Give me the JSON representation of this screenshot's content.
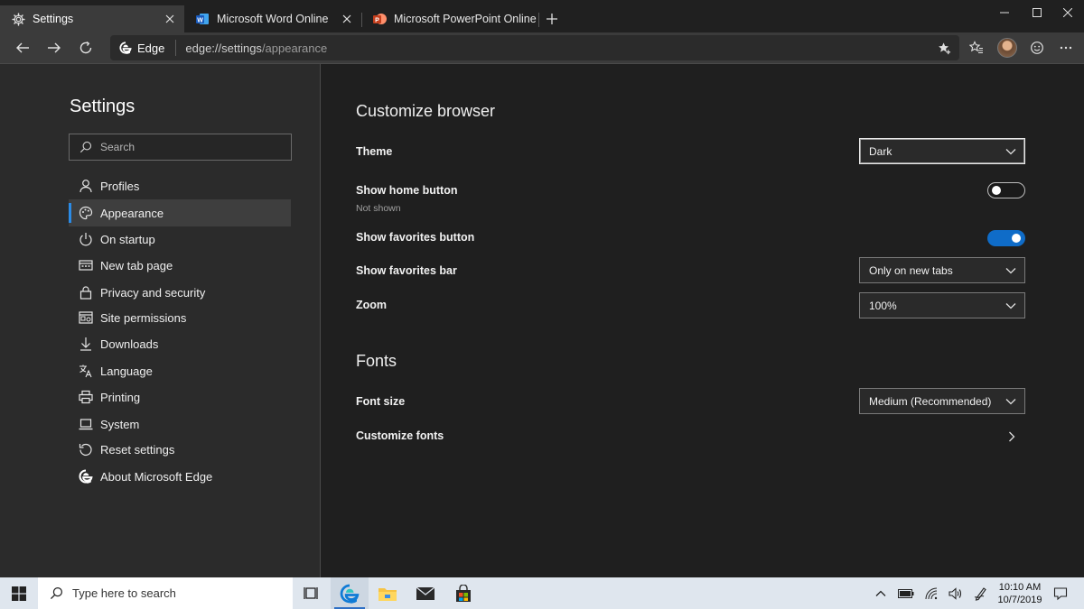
{
  "browser": {
    "tabs": [
      {
        "label": "Settings",
        "icon": "gear-icon"
      },
      {
        "label": "Microsoft Word Online",
        "icon": "word-icon"
      },
      {
        "label": "Microsoft PowerPoint Online",
        "icon": "powerpoint-icon"
      }
    ],
    "address": {
      "badge": "Edge",
      "host": "edge://settings",
      "path": "/appearance"
    }
  },
  "sidebar": {
    "title": "Settings",
    "search_placeholder": "Search",
    "items": [
      {
        "label": "Profiles",
        "icon": "person-icon"
      },
      {
        "label": "Appearance",
        "icon": "palette-icon"
      },
      {
        "label": "On startup",
        "icon": "power-icon"
      },
      {
        "label": "New tab page",
        "icon": "new-tab-page-icon"
      },
      {
        "label": "Privacy and security",
        "icon": "lock-icon"
      },
      {
        "label": "Site permissions",
        "icon": "site-permissions-icon"
      },
      {
        "label": "Downloads",
        "icon": "download-icon"
      },
      {
        "label": "Language",
        "icon": "language-icon"
      },
      {
        "label": "Printing",
        "icon": "printer-icon"
      },
      {
        "label": "System",
        "icon": "laptop-icon"
      },
      {
        "label": "Reset settings",
        "icon": "reset-icon"
      },
      {
        "label": "About Microsoft Edge",
        "icon": "edge-logo-icon"
      }
    ]
  },
  "main": {
    "customize": {
      "title": "Customize browser",
      "theme": {
        "label": "Theme",
        "value": "Dark"
      },
      "home_button": {
        "label": "Show home button",
        "sub": "Not shown",
        "enabled": false
      },
      "favorites_button": {
        "label": "Show favorites button",
        "enabled": true
      },
      "favorites_bar": {
        "label": "Show favorites bar",
        "value": "Only on new tabs"
      },
      "zoom": {
        "label": "Zoom",
        "value": "100%"
      }
    },
    "fonts": {
      "title": "Fonts",
      "font_size": {
        "label": "Font size",
        "value": "Medium (Recommended)"
      },
      "customize_fonts": {
        "label": "Customize fonts"
      }
    }
  },
  "taskbar": {
    "search_placeholder": "Type here to search",
    "time": "10:10 AM",
    "date": "10/7/2019"
  },
  "colors": {
    "accent": "#0f6cc8",
    "sidebar_active_indicator": "#2b8be6",
    "background": "#1f1f1f",
    "sidebar_bg": "#2b2b2b"
  }
}
